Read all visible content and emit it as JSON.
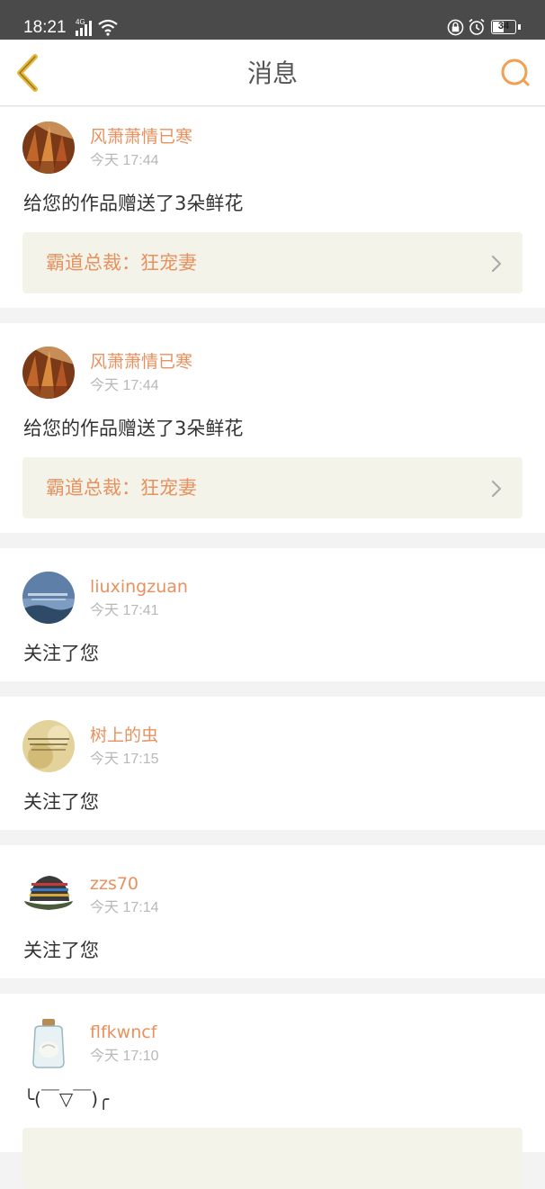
{
  "status_bar": {
    "time": "18:21",
    "network": "4G",
    "battery": "34"
  },
  "header": {
    "title": "消息"
  },
  "colors": {
    "accent": "#e8915e",
    "back_icon": "#e6b83a",
    "search_icon": "#f0a050"
  },
  "messages": [
    {
      "user": "风萧萧情已寒",
      "time": "今天 17:44",
      "content": "给您的作品赠送了3朵鲜花",
      "work_title": "霸道总裁：狂宠妻",
      "avatar": "autumn-trees"
    },
    {
      "user": "风萧萧情已寒",
      "time": "今天 17:44",
      "content": "给您的作品赠送了3朵鲜花",
      "work_title": "霸道总裁：狂宠妻",
      "avatar": "autumn-trees"
    },
    {
      "user": "liuxingzuan",
      "time": "今天 17:41",
      "content": "关注了您",
      "avatar": "sky-landscape"
    },
    {
      "user": "树上的虫",
      "time": "今天 17:15",
      "content": "关注了您",
      "avatar": "yellow-text-image"
    },
    {
      "user": "zzs70",
      "time": "今天 17:14",
      "content": "关注了您",
      "avatar": "knit-hat"
    },
    {
      "user": "flfkwncf",
      "time": "今天 17:10",
      "content": "╰(￣▽￣)╭",
      "avatar": "glass-jar"
    }
  ]
}
